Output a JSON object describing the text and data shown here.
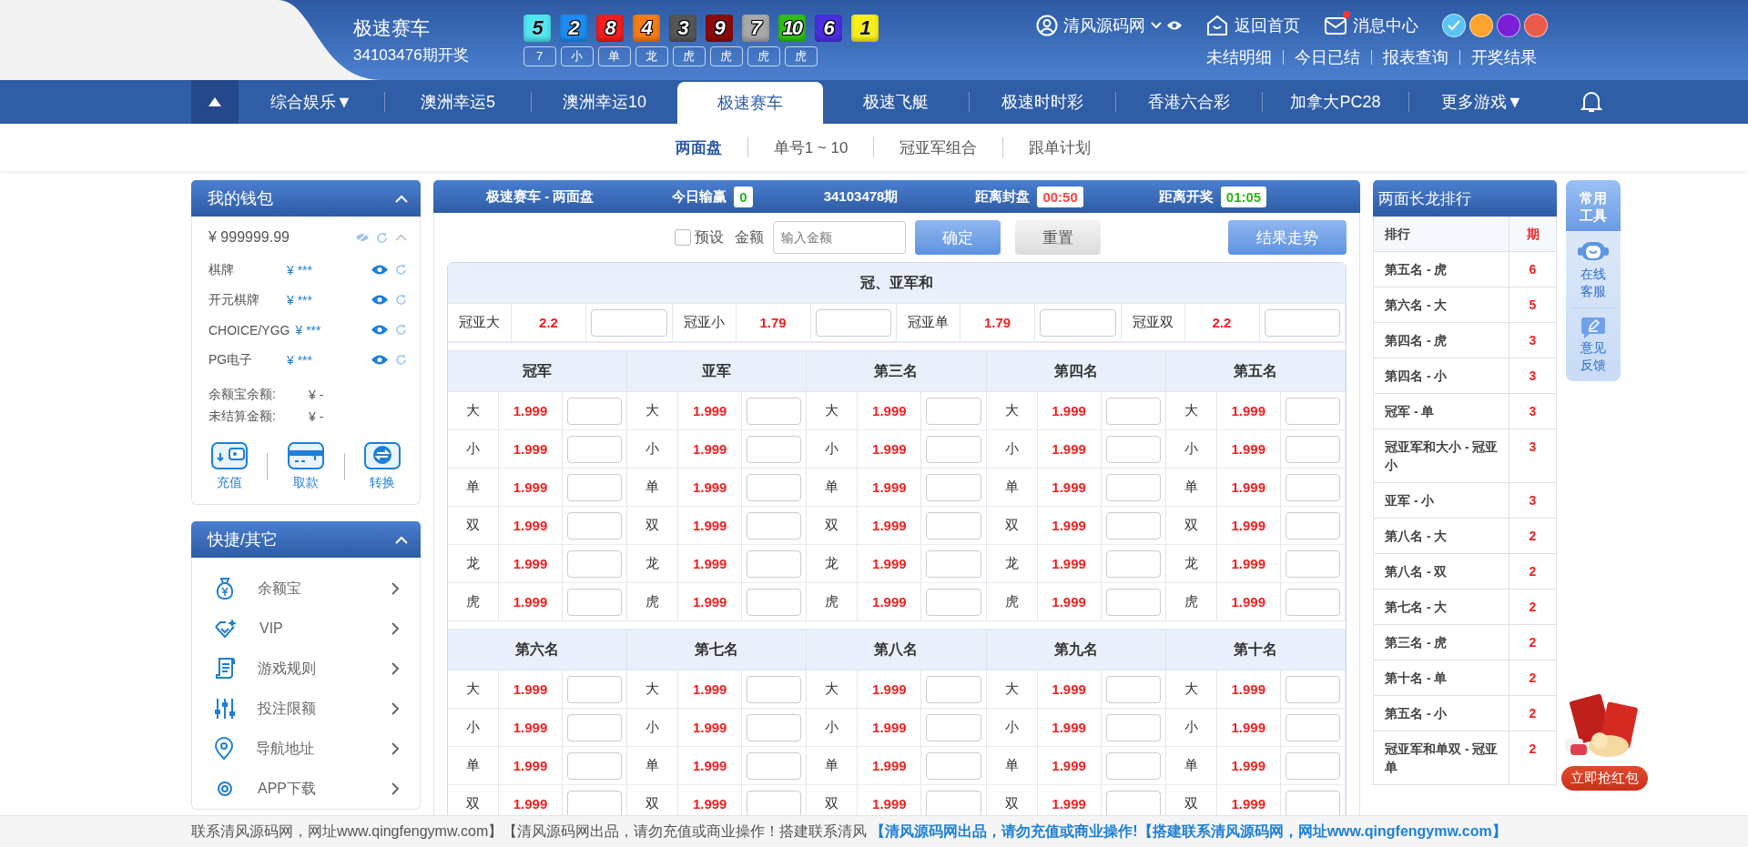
{
  "header": {
    "lottery": "极速赛车",
    "draw": "34103476期开奖",
    "balls": [
      {
        "number": "5",
        "color": "#4fe6f0"
      },
      {
        "number": "2",
        "color": "#1c8cf0"
      },
      {
        "number": "8",
        "color": "#f21d1d"
      },
      {
        "number": "4",
        "color": "#f57b16"
      },
      {
        "number": "3",
        "color": "#565656"
      },
      {
        "number": "9",
        "color": "#8c0a0a"
      },
      {
        "number": "7",
        "color": "#a8a8a8"
      },
      {
        "number": "10",
        "color": "#2fc012"
      },
      {
        "number": "6",
        "color": "#4a2fe0"
      },
      {
        "number": "1",
        "color": "#f7ef1a"
      }
    ],
    "results": [
      "7",
      "小",
      "单",
      "龙",
      "虎",
      "虎",
      "虎",
      "虎"
    ],
    "user": "清风源码网",
    "links": [
      {
        "label": "返回首页",
        "kind": "home",
        "unread": false
      },
      {
        "label": "消息中心",
        "kind": "mail",
        "unread": true
      }
    ],
    "themes": [
      {
        "color": "#5bc4f5",
        "selected": true
      },
      {
        "color": "#fda22b",
        "selected": false
      },
      {
        "color": "#7a1fd6",
        "selected": false
      },
      {
        "color": "#ec5a4c",
        "selected": false
      }
    ],
    "quick_links": [
      "未结明细",
      "今日已结",
      "报表查询",
      "开奖结果"
    ]
  },
  "nav": {
    "tabs": [
      {
        "label": "综合娱乐▼",
        "selected": false
      },
      {
        "label": "澳洲幸运5",
        "selected": false
      },
      {
        "label": "澳洲幸运10",
        "selected": false
      },
      {
        "label": "极速赛车",
        "selected": true
      },
      {
        "label": "极速飞艇",
        "selected": false
      },
      {
        "label": "极速时时彩",
        "selected": false
      },
      {
        "label": "香港六合彩",
        "selected": false
      },
      {
        "label": "加拿大PC28",
        "selected": false
      },
      {
        "label": "更多游戏▼",
        "selected": false
      }
    ]
  },
  "subnav": [
    {
      "label": "两面盘",
      "selected": true
    },
    {
      "label": "单号1 ~ 10",
      "selected": false
    },
    {
      "label": "冠亚军组合",
      "selected": false
    },
    {
      "label": "跟单计划",
      "selected": false
    }
  ],
  "wallet": {
    "title": "我的钱包",
    "balance": "¥ 999999.99",
    "accounts": [
      {
        "name": "棋牌",
        "amount": "¥ ***"
      },
      {
        "name": "开元棋牌",
        "amount": "¥ ***"
      },
      {
        "name": "CHOICE/YGG",
        "amount": "¥ ***"
      },
      {
        "name": "PG电子",
        "amount": "¥ ***"
      }
    ],
    "summary": [
      {
        "label": "余额宝余额:",
        "value": "¥ -"
      },
      {
        "label": "未结算金额:",
        "value": "¥ -"
      }
    ],
    "actions": [
      {
        "label": "充值",
        "kind": "deposit"
      },
      {
        "label": "取款",
        "kind": "withdraw"
      },
      {
        "label": "转换",
        "kind": "transfer"
      }
    ]
  },
  "shortcuts": {
    "title": "快捷/其它",
    "items": [
      {
        "label": "余额宝",
        "kind": "moneybag"
      },
      {
        "label": "VIP",
        "kind": "vip"
      },
      {
        "label": "游戏规则",
        "kind": "rules"
      },
      {
        "label": "投注限额",
        "kind": "limits"
      },
      {
        "label": "导航地址",
        "kind": "location"
      },
      {
        "label": "APP下载",
        "kind": "app"
      }
    ]
  },
  "board": {
    "title": "极速赛车 - 两面盘",
    "profit_label": "今日输赢",
    "profit": "0",
    "period": "34103478期",
    "close_label": "距离封盘",
    "close_time": "00:50",
    "open_label": "距离开奖",
    "open_time": "01:05",
    "preset": {
      "label": "预设",
      "checked": false
    },
    "amount_label": "金额",
    "amount_placeholder": "输入金额",
    "confirm": "确定",
    "reset": "重置",
    "trend": "结果走势",
    "sum_title": "冠、亚军和",
    "sum": [
      {
        "name": "冠亚大",
        "odds": "2.2"
      },
      {
        "name": "冠亚小",
        "odds": "1.79"
      },
      {
        "name": "冠亚单",
        "odds": "1.79"
      },
      {
        "name": "冠亚双",
        "odds": "2.2"
      }
    ],
    "groups": [
      {
        "columns": [
          {
            "title": "冠军",
            "rows": [
              {
                "name": "大",
                "odds": "1.999"
              },
              {
                "name": "小",
                "odds": "1.999"
              },
              {
                "name": "单",
                "odds": "1.999"
              },
              {
                "name": "双",
                "odds": "1.999"
              },
              {
                "name": "龙",
                "odds": "1.999"
              },
              {
                "name": "虎",
                "odds": "1.999"
              }
            ]
          },
          {
            "title": "亚军",
            "rows": [
              {
                "name": "大",
                "odds": "1.999"
              },
              {
                "name": "小",
                "odds": "1.999"
              },
              {
                "name": "单",
                "odds": "1.999"
              },
              {
                "name": "双",
                "odds": "1.999"
              },
              {
                "name": "龙",
                "odds": "1.999"
              },
              {
                "name": "虎",
                "odds": "1.999"
              }
            ]
          },
          {
            "title": "第三名",
            "rows": [
              {
                "name": "大",
                "odds": "1.999"
              },
              {
                "name": "小",
                "odds": "1.999"
              },
              {
                "name": "单",
                "odds": "1.999"
              },
              {
                "name": "双",
                "odds": "1.999"
              },
              {
                "name": "龙",
                "odds": "1.999"
              },
              {
                "name": "虎",
                "odds": "1.999"
              }
            ]
          },
          {
            "title": "第四名",
            "rows": [
              {
                "name": "大",
                "odds": "1.999"
              },
              {
                "name": "小",
                "odds": "1.999"
              },
              {
                "name": "单",
                "odds": "1.999"
              },
              {
                "name": "双",
                "odds": "1.999"
              },
              {
                "name": "龙",
                "odds": "1.999"
              },
              {
                "name": "虎",
                "odds": "1.999"
              }
            ]
          },
          {
            "title": "第五名",
            "rows": [
              {
                "name": "大",
                "odds": "1.999"
              },
              {
                "name": "小",
                "odds": "1.999"
              },
              {
                "name": "单",
                "odds": "1.999"
              },
              {
                "name": "双",
                "odds": "1.999"
              },
              {
                "name": "龙",
                "odds": "1.999"
              },
              {
                "name": "虎",
                "odds": "1.999"
              }
            ]
          }
        ]
      },
      {
        "columns": [
          {
            "title": "第六名",
            "rows": [
              {
                "name": "大",
                "odds": "1.999"
              },
              {
                "name": "小",
                "odds": "1.999"
              },
              {
                "name": "单",
                "odds": "1.999"
              },
              {
                "name": "双",
                "odds": "1.999"
              }
            ]
          },
          {
            "title": "第七名",
            "rows": [
              {
                "name": "大",
                "odds": "1.999"
              },
              {
                "name": "小",
                "odds": "1.999"
              },
              {
                "name": "单",
                "odds": "1.999"
              },
              {
                "name": "双",
                "odds": "1.999"
              }
            ]
          },
          {
            "title": "第八名",
            "rows": [
              {
                "name": "大",
                "odds": "1.999"
              },
              {
                "name": "小",
                "odds": "1.999"
              },
              {
                "name": "单",
                "odds": "1.999"
              },
              {
                "name": "双",
                "odds": "1.999"
              }
            ]
          },
          {
            "title": "第九名",
            "rows": [
              {
                "name": "大",
                "odds": "1.999"
              },
              {
                "name": "小",
                "odds": "1.999"
              },
              {
                "name": "单",
                "odds": "1.999"
              },
              {
                "name": "双",
                "odds": "1.999"
              }
            ]
          },
          {
            "title": "第十名",
            "rows": [
              {
                "name": "大",
                "odds": "1.999"
              },
              {
                "name": "小",
                "odds": "1.999"
              },
              {
                "name": "单",
                "odds": "1.999"
              },
              {
                "name": "双",
                "odds": "1.999"
              }
            ]
          }
        ]
      }
    ]
  },
  "ranking": {
    "title": "两面长龙排行",
    "col_name": "排行",
    "col_count": "期",
    "rows": [
      {
        "name": "第五名 - 虎",
        "count": "6"
      },
      {
        "name": "第六名 - 大",
        "count": "5"
      },
      {
        "name": "第四名 - 虎",
        "count": "3"
      },
      {
        "name": "第四名 - 小",
        "count": "3"
      },
      {
        "name": "冠军 - 单",
        "count": "3"
      },
      {
        "name": "冠亚军和大小 - 冠亚小",
        "count": "3"
      },
      {
        "name": "亚军 - 小",
        "count": "3"
      },
      {
        "name": "第八名 - 大",
        "count": "2"
      },
      {
        "name": "第八名 - 双",
        "count": "2"
      },
      {
        "name": "第七名 - 大",
        "count": "2"
      },
      {
        "name": "第三名 - 虎",
        "count": "2"
      },
      {
        "name": "第十名 - 单",
        "count": "2"
      },
      {
        "name": "第五名 - 小",
        "count": "2"
      },
      {
        "name": "冠亚军和单双 - 冠亚单",
        "count": "2"
      }
    ]
  },
  "tools": {
    "title": "常用工具",
    "items": [
      {
        "label": "在线客服",
        "kind": "support"
      },
      {
        "label": "意见反馈",
        "kind": "feedback"
      }
    ]
  },
  "red_packet": {
    "label": "立即抢红包"
  },
  "notice": {
    "text": "联系清风源码网，网址www.qingfengymw.com】【清风源码网出品，请勿充值或商业操作！搭建联系清风",
    "highlight": "【清风源码网出品，请勿充值或商业操作!【搭建联系清风源码网，网址www.qingfengymw.com】"
  }
}
